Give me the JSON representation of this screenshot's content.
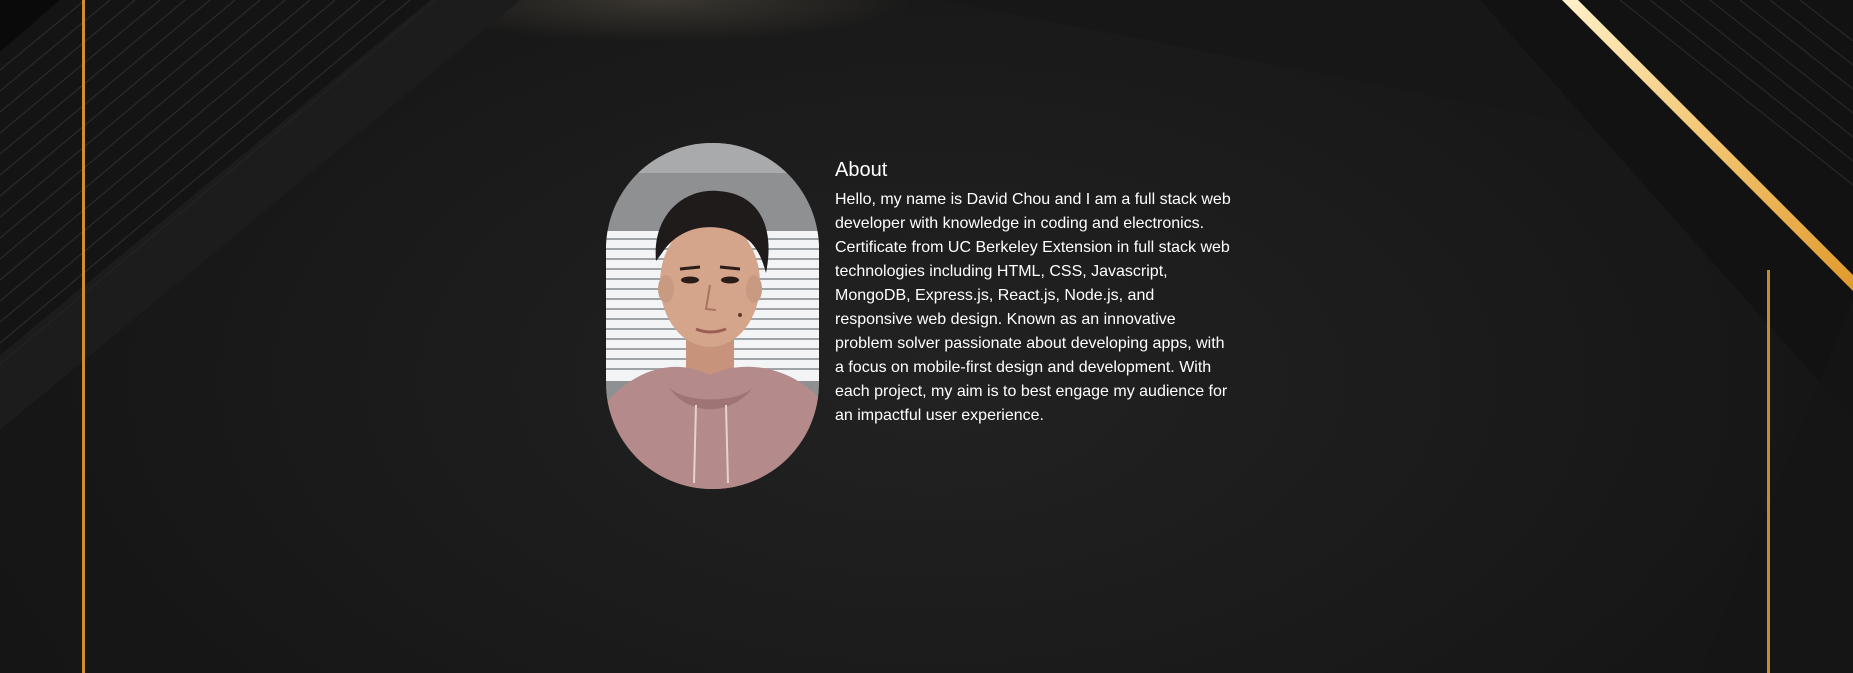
{
  "about": {
    "title": "About",
    "body": "Hello, my name is David Chou and I am a full stack web developer with knowledge in coding and electronics. Certificate from UC Berkeley Extension in full stack web technologies including HTML, CSS, Javascript, MongoDB, Express.js, React.js, Node.js, and responsive web design. Known as an innovative problem solver passionate about developing apps, with a focus on mobile-first design and development. With each project, my aim is to best engage my audience for an impactful user experience.",
    "photo_icon": "profile-photo"
  },
  "colors": {
    "background": "#1c1c1c",
    "gold_accent": "#e8a33a",
    "text": "#ffffff"
  }
}
